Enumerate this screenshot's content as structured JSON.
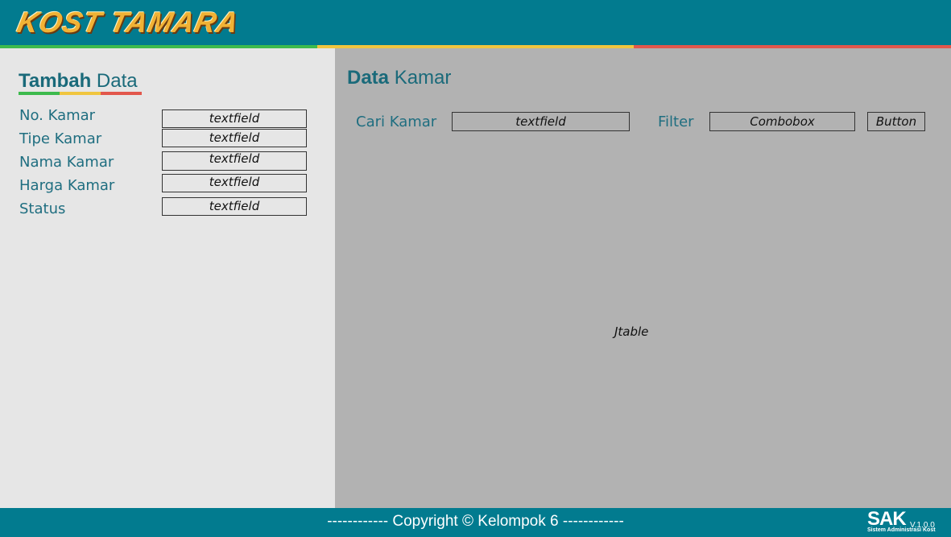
{
  "header": {
    "logo_text": "KOST TAMARA"
  },
  "stripe_colors": {
    "green": "#3dba4d",
    "yellow": "#f0c53f",
    "red": "#e2574c"
  },
  "left": {
    "title_bold": "Tambah",
    "title_light": "Data",
    "fields": [
      {
        "label": "No. Kamar",
        "placeholder": "textfield"
      },
      {
        "label": "Tipe Kamar",
        "placeholder": "textfield"
      },
      {
        "label": "Nama Kamar",
        "placeholder": "textfield"
      },
      {
        "label": "Harga Kamar",
        "placeholder": "textfield"
      },
      {
        "label": "Status",
        "placeholder": "textfield"
      }
    ]
  },
  "right": {
    "title_bold": "Data",
    "title_light": "Kamar",
    "search_label": "Cari Kamar",
    "search_field": "textfield",
    "filter_label": "Filter",
    "filter_combo": "Combobox",
    "button_label": "Button",
    "table_label": "Jtable"
  },
  "footer": {
    "copyright": "------------ Copyright © Kelompok 6 ------------",
    "brand": "SAK",
    "version": "V.1.0.0",
    "brand_sub": "Sistem Administrasi Kost"
  },
  "colors": {
    "header_bg": "#027b8f",
    "right_bg": "#b2b2b2",
    "left_bg": "#e6e6e6",
    "accent_text": "#1a6a7a"
  }
}
